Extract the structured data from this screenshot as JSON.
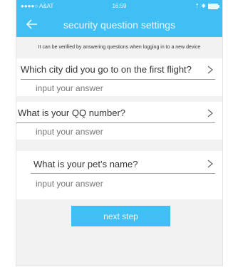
{
  "status_bar": {
    "carrier": "●●●●○ A&AT",
    "time": "16:59",
    "indicators": "⇡ ✱"
  },
  "header": {
    "title": "security question settings",
    "back_icon": "back-arrow-icon"
  },
  "hint": "It can be verified by answering questions when logging in to a new device",
  "questions": [
    {
      "label": "Which city did you go to on the first flight?",
      "placeholder": "input your answer"
    },
    {
      "label": "What is your QQ number?",
      "placeholder": "input your answer"
    },
    {
      "label": "What is your pet’s name?",
      "placeholder": "input your answer"
    }
  ],
  "next_button": "next step",
  "colors": {
    "accent": "#40bff5",
    "background": "#f2f2f2",
    "text": "#333333"
  }
}
